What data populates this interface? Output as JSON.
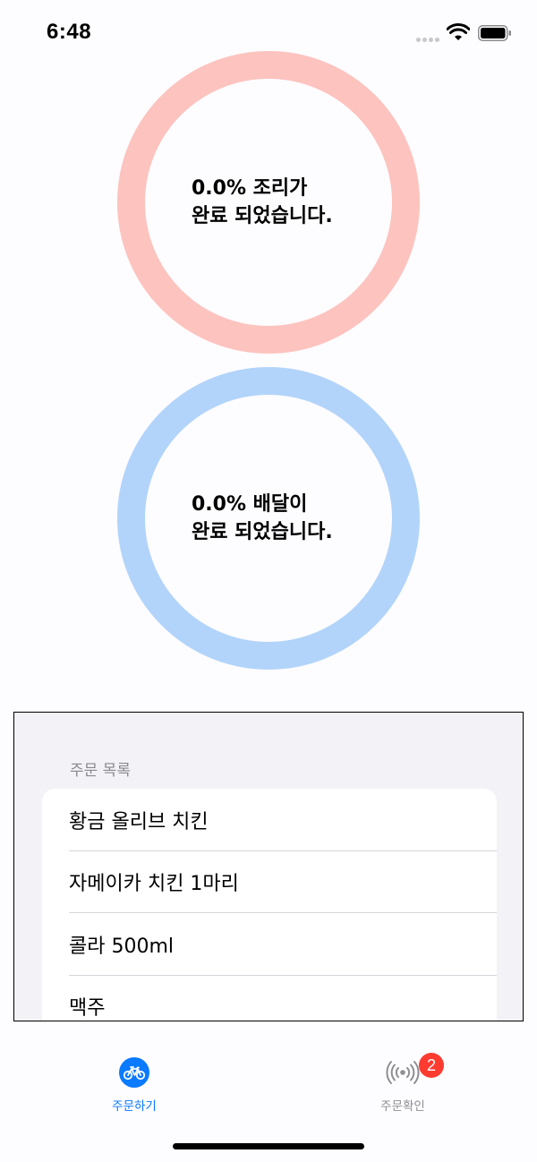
{
  "status_bar": {
    "time": "6:48"
  },
  "cook_progress": {
    "percent": 0.0,
    "line1": "0.0% 조리가",
    "line2": "완료 되었습니다.",
    "ring_color": "#fdc3be"
  },
  "delivery_progress": {
    "percent": 0.0,
    "line1": "0.0% 배달이",
    "line2": "완료 되었습니다.",
    "ring_color": "#b2d4fa"
  },
  "order_list": {
    "header": "주문 목록",
    "items": [
      {
        "label": "황금 올리브 치킨"
      },
      {
        "label": "자메이카 치킨 1마리"
      },
      {
        "label": "콜라 500ml"
      },
      {
        "label": "맥주"
      }
    ]
  },
  "tab_bar": {
    "tabs": [
      {
        "label": "주문하기",
        "icon": "bicycle-icon",
        "selected": true
      },
      {
        "label": "주문확인",
        "icon": "broadcast-icon",
        "badge": "2",
        "selected": false
      }
    ],
    "accent_color": "#0a7aff",
    "badge_color": "#ff3b30"
  }
}
